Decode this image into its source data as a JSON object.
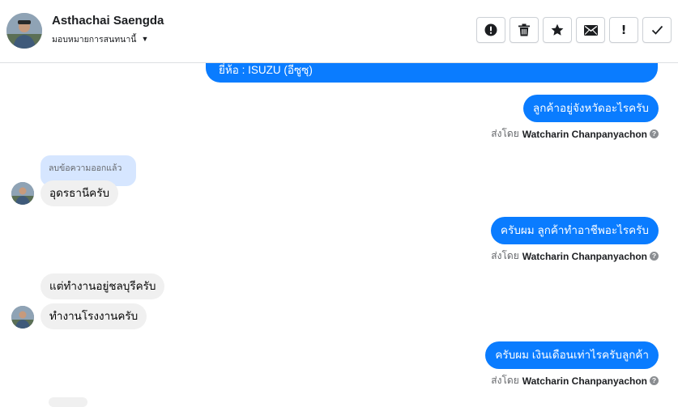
{
  "header": {
    "contact_name": "Asthachai Saengda",
    "assign_label": "มอบหมายการสนทนานี้",
    "toolbar": [
      {
        "name": "mark-spam-button",
        "icon": "alert-circle-icon"
      },
      {
        "name": "delete-button",
        "icon": "trash-icon"
      },
      {
        "name": "star-button",
        "icon": "star-icon"
      },
      {
        "name": "mark-unread-button",
        "icon": "envelope-icon"
      },
      {
        "name": "follow-up-button",
        "icon": "exclamation-icon"
      },
      {
        "name": "mark-done-button",
        "icon": "checkmark-icon"
      }
    ]
  },
  "messages": {
    "m0": "ยี่ห้อ : ISUZU (อีซูซุ)",
    "m1": "ลูกค้าอยู่จังหวัดอะไรครับ",
    "sent1_prefix": "ส่งโดย",
    "sent1_name": "Watcharin Chanpanyachon",
    "deleted_label": "ลบข้อความออกแล้ว",
    "m2": "อุดรธานีครับ",
    "m3": "ครับผม ลูกค้าทำอาชีพอะไรครับ",
    "sent2_prefix": "ส่งโดย",
    "sent2_name": "Watcharin Chanpanyachon",
    "m4": "แต่ทำงานอยู่ชลบุรีครับ",
    "m5": "ทำงานโรงงานครับ",
    "m6": "ครับผม เงินเดือนเท่าไรครับลูกค้า",
    "sent3_prefix": "ส่งโดย",
    "sent3_name": "Watcharin Chanpanyachon"
  },
  "colors": {
    "outgoing_bubble": "#0a7cff",
    "incoming_bubble": "#f0f0f0",
    "deleted_bubble": "#d6e6ff"
  }
}
